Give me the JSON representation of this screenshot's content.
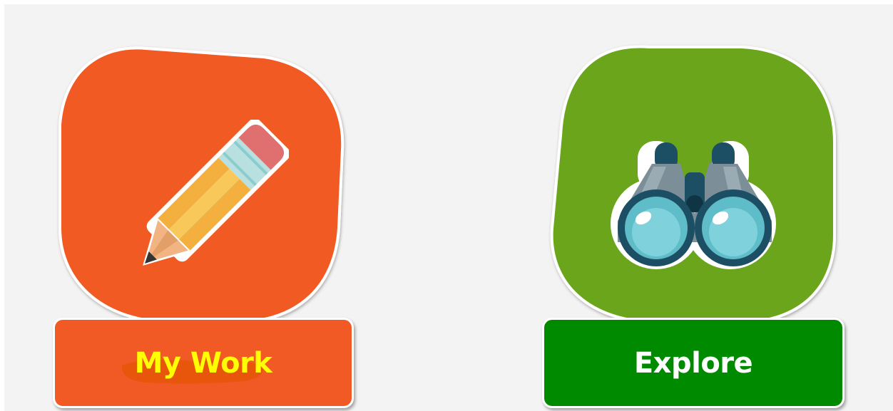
{
  "tiles": [
    {
      "id": "my-work",
      "label": "My Work",
      "icon": "pencil-icon",
      "tile_color": "#f15a24",
      "label_color": "#ffff00",
      "label_bg": "#f15a24"
    },
    {
      "id": "explore",
      "label": "Explore",
      "icon": "binoculars-icon",
      "tile_color": "#6ba51e",
      "label_color": "#ffffff",
      "label_bg": "#008a00"
    }
  ]
}
